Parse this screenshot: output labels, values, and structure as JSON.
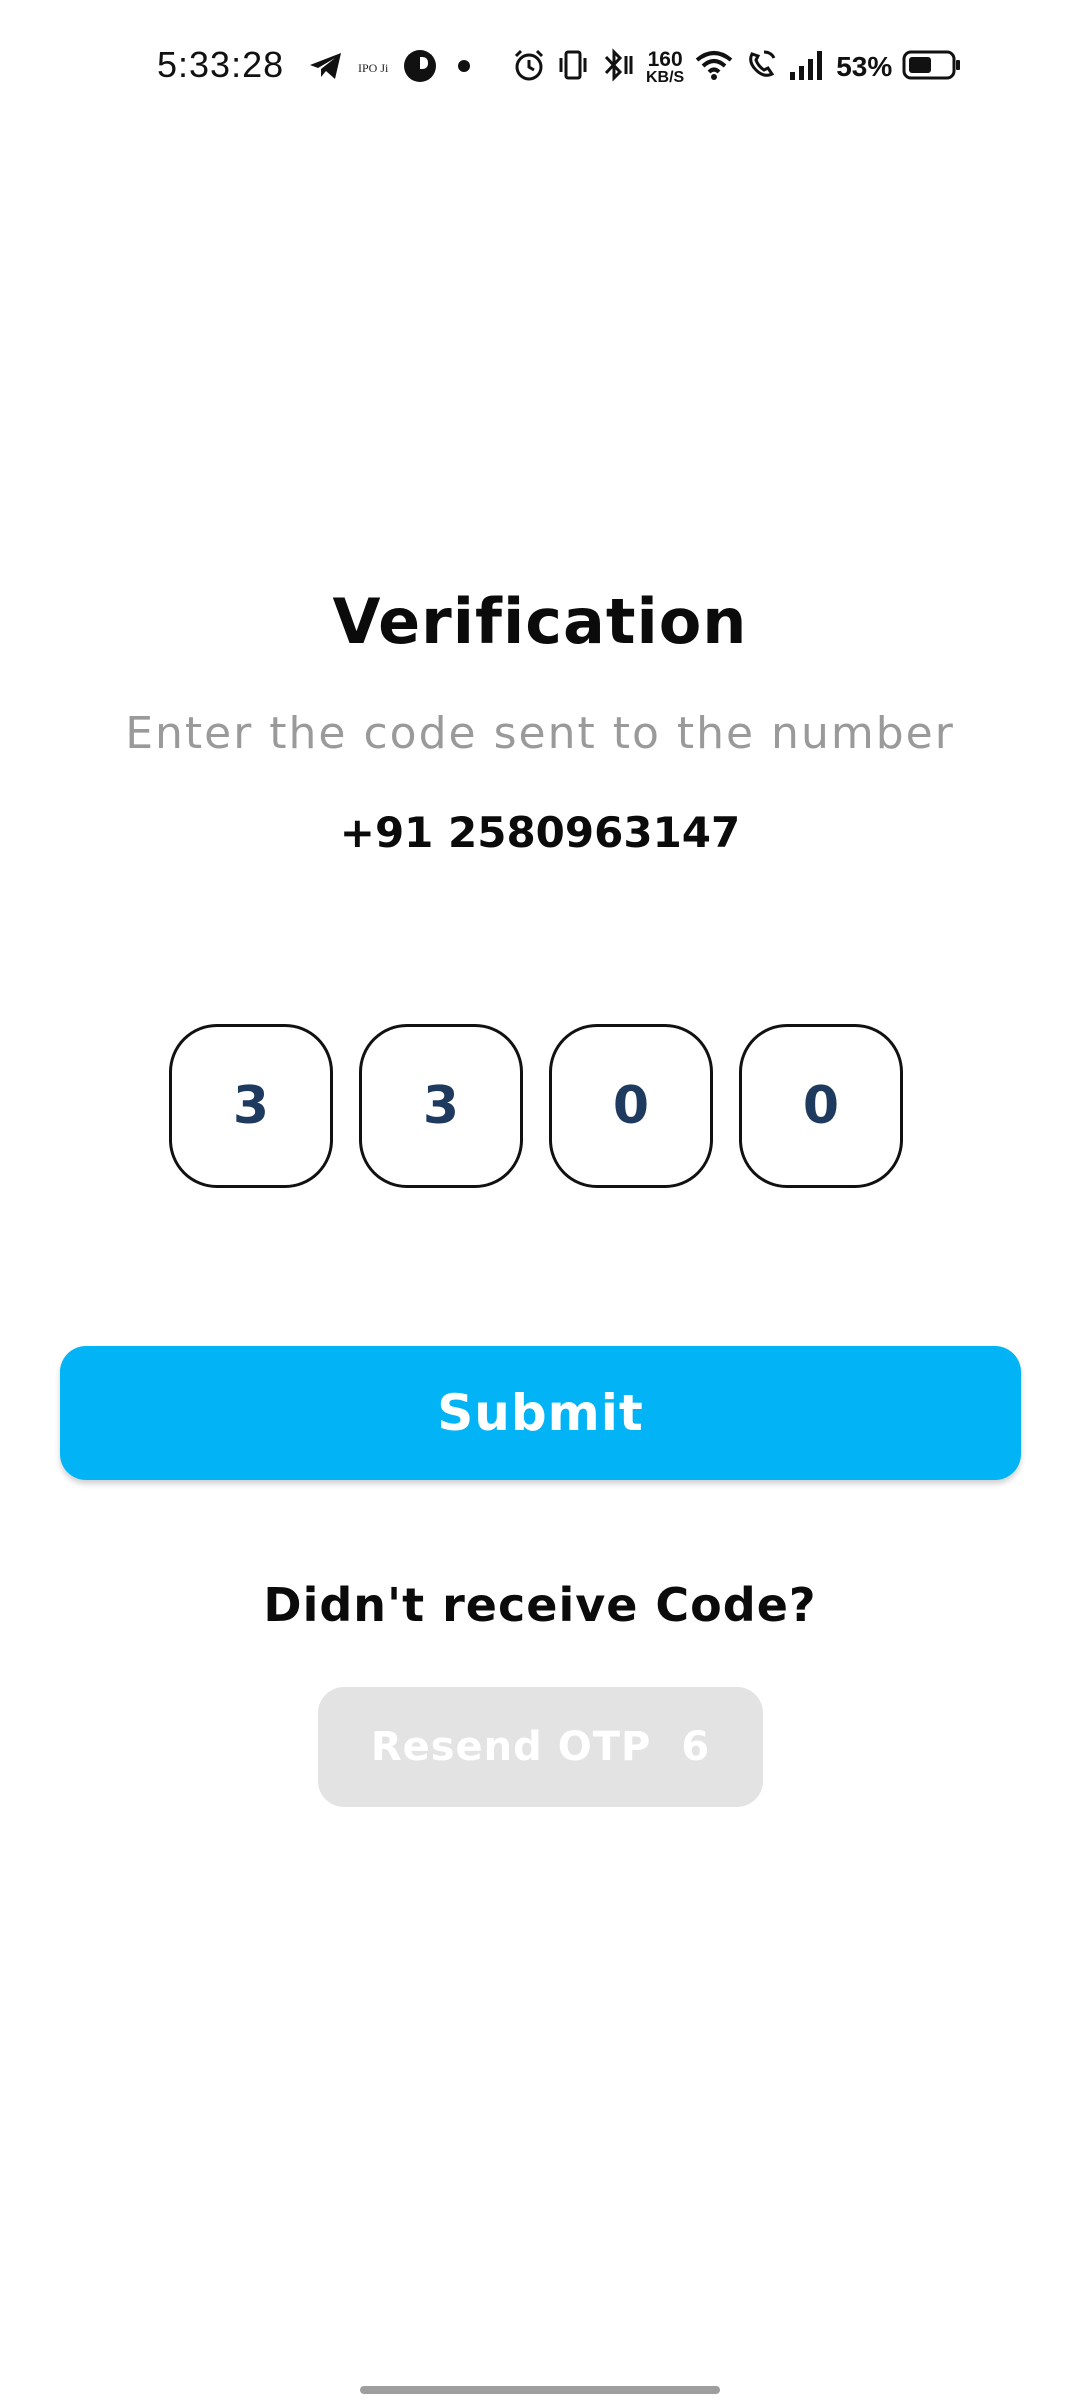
{
  "status_bar": {
    "time": "5:33:28",
    "ipo_label": "IPO Ji",
    "net_speed_value": "160",
    "net_speed_unit": "KB/S",
    "battery_percent": "53%",
    "icons": [
      "telegram-icon",
      "ipo-ji-icon",
      "app-icon",
      "dot-icon",
      "alarm-icon",
      "vibrate-icon",
      "bluetooth-icon",
      "wifi-icon",
      "wifi-calling-icon",
      "signal-icon",
      "battery-icon"
    ]
  },
  "verification": {
    "title": "Verification",
    "subtitle": "Enter the code sent to the number",
    "phone_number": "+91 2580963147",
    "otp_digits": [
      "3",
      "3",
      "0",
      "0"
    ],
    "submit_label": "Submit",
    "didnt_receive_label": "Didn't receive Code?",
    "resend_label": "Resend OTP",
    "resend_countdown": "6"
  },
  "colors": {
    "accent": "#02b4f6",
    "otp_digit": "#1e3a5f",
    "subtitle": "#9a9a9a",
    "disabled_button": "#e3e3e3"
  }
}
